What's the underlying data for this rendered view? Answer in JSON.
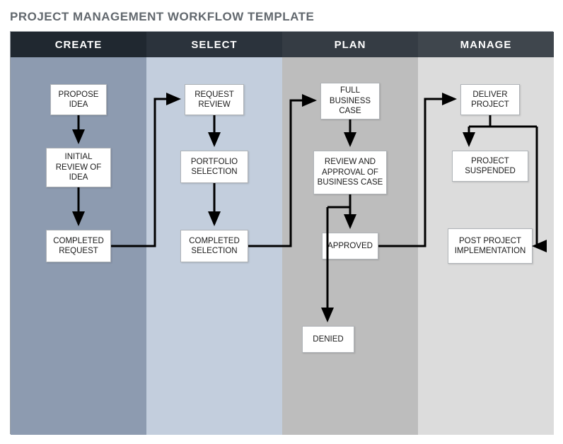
{
  "title": "PROJECT MANAGEMENT WORKFLOW TEMPLATE",
  "columns": [
    {
      "label": "CREATE",
      "header_bg": "#202830",
      "body_bg": "#8d9bb0"
    },
    {
      "label": "SELECT",
      "header_bg": "#2b333c",
      "body_bg": "#c3cedd"
    },
    {
      "label": "PLAN",
      "header_bg": "#353c44",
      "body_bg": "#bdbdbd"
    },
    {
      "label": "MANAGE",
      "header_bg": "#3f464d",
      "body_bg": "#dcdcdc"
    }
  ],
  "boxes": {
    "propose_idea": "PROPOSE IDEA",
    "initial_review": "INITIAL REVIEW OF IDEA",
    "completed_request": "COMPLETED REQUEST",
    "request_review": "REQUEST REVIEW",
    "portfolio_selection": "PORTFOLIO SELECTION",
    "completed_selection": "COMPLETED SELECTION",
    "full_business_case": "FULL BUSINESS CASE",
    "review_approval": "REVIEW AND APPROVAL OF BUSINESS CASE",
    "approved": "APPROVED",
    "denied": "DENIED",
    "deliver_project": "DELIVER PROJECT",
    "project_suspended": "PROJECT SUSPENDED",
    "post_project": "POST PROJECT IMPLEMENTATION"
  }
}
